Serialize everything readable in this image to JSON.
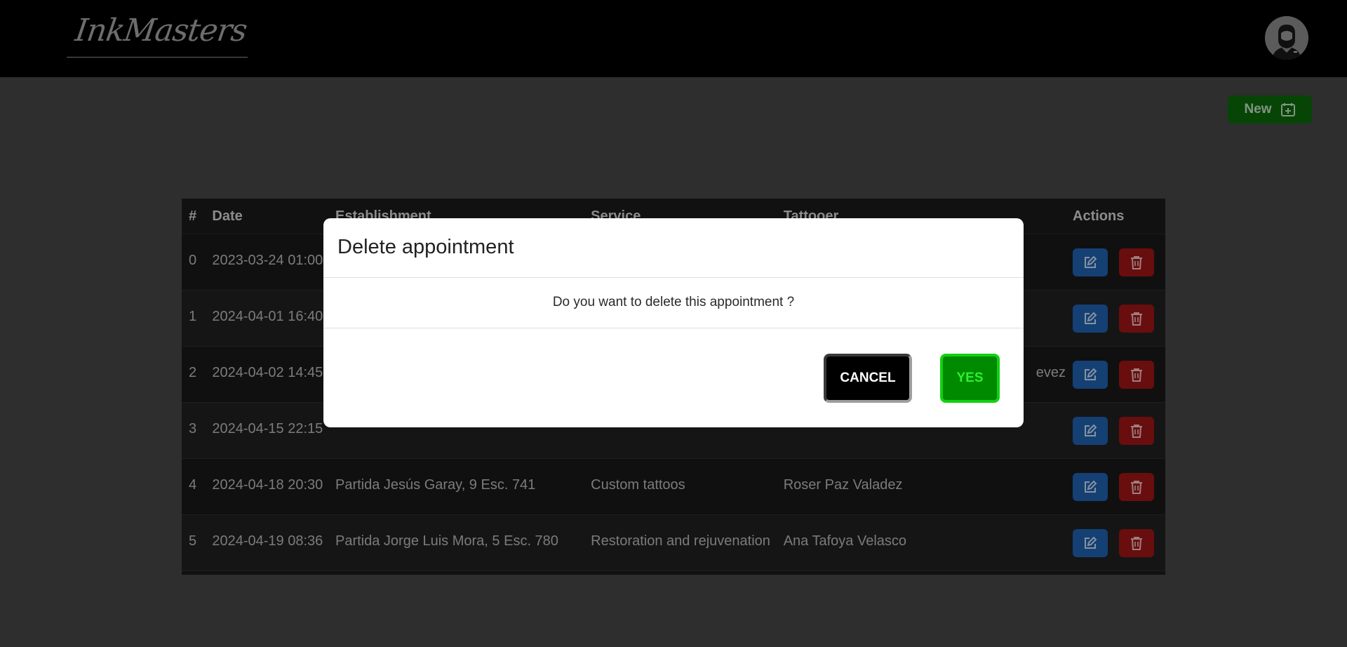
{
  "brand": {
    "logo_text": "InkMasters"
  },
  "toolbar": {
    "new_label": "New"
  },
  "table": {
    "headers": [
      "#",
      "Date",
      "Establishment",
      "Service",
      "Tattooer",
      "Actions"
    ],
    "rows": [
      {
        "id": "0",
        "date": "2023-03-24 01:00",
        "establishment": "",
        "service": "",
        "tattooer": ""
      },
      {
        "id": "1",
        "date": "2024-04-01 16:40",
        "establishment": "",
        "service": "",
        "tattooer": ""
      },
      {
        "id": "2",
        "date": "2024-04-02 14:45",
        "establishment": "",
        "service": "",
        "tattooer": "evez"
      },
      {
        "id": "3",
        "date": "2024-04-15 22:15",
        "establishment": "",
        "service": "",
        "tattooer": ""
      },
      {
        "id": "4",
        "date": "2024-04-18 20:30",
        "establishment": "Partida Jesús Garay, 9 Esc. 741",
        "service": "Custom tattoos",
        "tattooer": "Roser Paz Valadez"
      },
      {
        "id": "5",
        "date": "2024-04-19 08:36",
        "establishment": "Partida Jorge Luis Mora, 5 Esc. 780",
        "service": "Restoration and rejuvenation",
        "tattooer": "Ana Tafoya Velasco"
      }
    ]
  },
  "modal": {
    "title": "Delete appointment",
    "message": "Do you want to delete this appointment ?",
    "cancel_label": "CANCEL",
    "yes_label": "YES"
  },
  "icons": {
    "avatar": "user-avatar-icon",
    "new": "calendar-plus-icon",
    "edit": "edit-icon",
    "delete": "trash-icon"
  },
  "colors": {
    "header_bg": "#000000",
    "page_bg": "#474747",
    "new_button": "#0a6b0a",
    "edit_button": "#1f63b2",
    "delete_button": "#a11616",
    "yes_button": "#008a00"
  }
}
